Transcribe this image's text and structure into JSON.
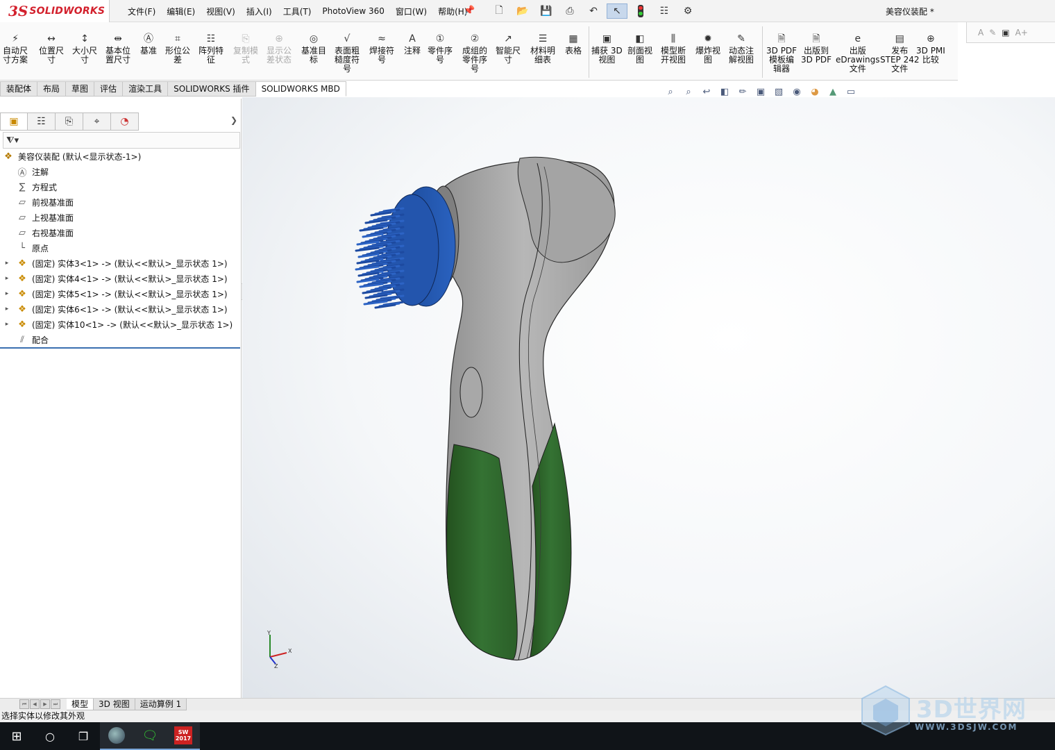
{
  "app": {
    "logo_mark": "3S",
    "logo_text": "SOLIDWORKS",
    "document_title": "美容仪装配 *"
  },
  "menus": [
    "文件(F)",
    "编辑(E)",
    "视图(V)",
    "插入(I)",
    "工具(T)",
    "PhotoView 360",
    "窗口(W)",
    "帮助(H)"
  ],
  "quick_icons": [
    "new-document-icon",
    "open-icon",
    "save-icon",
    "print-icon",
    "undo-icon",
    "select-pointer-icon",
    "rebuild-traffic-light-icon",
    "file-properties-icon",
    "options-gear-icon"
  ],
  "commands": [
    {
      "label": "自动尺\n寸方案",
      "icon": "auto-dimension-icon",
      "enabled": true
    },
    {
      "label": "位置尺\n寸",
      "icon": "location-dimension-icon",
      "enabled": true
    },
    {
      "label": "大小尺\n寸",
      "icon": "size-dimension-icon",
      "enabled": true
    },
    {
      "label": "基本位\n置尺寸",
      "icon": "basic-location-dimension-icon",
      "enabled": true
    },
    {
      "label": "基准",
      "icon": "datum-icon",
      "enabled": true
    },
    {
      "label": "形位公\n差",
      "icon": "geometric-tolerance-icon",
      "enabled": true
    },
    {
      "label": "阵列特\n征",
      "icon": "pattern-feature-icon",
      "enabled": true
    },
    {
      "label": "复制模\n式",
      "icon": "copy-scheme-icon",
      "enabled": false
    },
    {
      "label": "显示公\n差状态",
      "icon": "tolerance-status-icon",
      "enabled": false
    },
    {
      "label": "基准目\n标",
      "icon": "datum-target-icon",
      "enabled": true
    },
    {
      "label": "表面粗\n糙度符\n号",
      "icon": "surface-finish-icon",
      "enabled": true
    },
    {
      "label": "焊接符\n号",
      "icon": "weld-symbol-icon",
      "enabled": true
    },
    {
      "label": "注释",
      "icon": "note-icon",
      "enabled": true
    },
    {
      "label": "零件序\n号",
      "icon": "balloon-icon",
      "enabled": true
    },
    {
      "label": "成组的\n零件序\n号",
      "icon": "stacked-balloon-icon",
      "enabled": true
    },
    {
      "label": "智能尺\n寸",
      "icon": "smart-dimension-icon",
      "enabled": true
    },
    {
      "label": "材料明\n细表",
      "icon": "bom-icon",
      "enabled": true
    },
    {
      "label": "表格",
      "icon": "table-icon",
      "enabled": true
    },
    {
      "label": "捕获 3D\n视图",
      "icon": "capture-3d-view-icon",
      "enabled": true
    },
    {
      "label": "剖面视\n图",
      "icon": "section-view-icon",
      "enabled": true
    },
    {
      "label": "模型断\n开视图",
      "icon": "model-break-view-icon",
      "enabled": true
    },
    {
      "label": "爆炸视\n图",
      "icon": "exploded-view-icon",
      "enabled": true
    },
    {
      "label": "动态注\n解视图",
      "icon": "dynamic-annotation-icon",
      "enabled": true
    },
    {
      "label": "3D PDF\n模板编\n辑器",
      "icon": "3d-pdf-template-icon",
      "enabled": true
    },
    {
      "label": "出版到\n3D PDF",
      "icon": "publish-3d-pdf-icon",
      "enabled": true
    },
    {
      "label": "出版\neDrawings\n文件",
      "icon": "edrawings-icon",
      "enabled": true
    },
    {
      "label": "发布\nSTEP 242\n文件",
      "icon": "step-242-icon",
      "enabled": true
    },
    {
      "label": "3D PMI\n比较",
      "icon": "pmi-compare-icon",
      "enabled": true
    }
  ],
  "command_tabs": [
    "装配体",
    "布局",
    "草图",
    "评估",
    "渲染工具",
    "SOLIDWORKS 插件",
    "SOLIDWORKS MBD"
  ],
  "active_command_tab": "SOLIDWORKS MBD",
  "feature_tree": {
    "root": "美容仪装配  (默认<显示状态-1>)",
    "items": [
      {
        "label": "注解",
        "icon": "annotations-icon",
        "expandable": false
      },
      {
        "label": "方程式",
        "icon": "equations-icon",
        "expandable": false
      },
      {
        "label": "前视基准面",
        "icon": "plane-icon",
        "expandable": false
      },
      {
        "label": "上视基准面",
        "icon": "plane-icon",
        "expandable": false
      },
      {
        "label": "右视基准面",
        "icon": "plane-icon",
        "expandable": false
      },
      {
        "label": "原点",
        "icon": "origin-icon",
        "expandable": false
      },
      {
        "label": "(固定) 实体3<1> -> (默认<<默认>_显示状态 1>)",
        "icon": "part-icon",
        "expandable": true
      },
      {
        "label": "(固定) 实体4<1> -> (默认<<默认>_显示状态 1>)",
        "icon": "part-icon",
        "expandable": true
      },
      {
        "label": "(固定) 实体5<1> -> (默认<<默认>_显示状态 1>)",
        "icon": "part-icon",
        "expandable": true
      },
      {
        "label": "(固定) 实体6<1> -> (默认<<默认>_显示状态 1>)",
        "icon": "part-icon",
        "expandable": true
      },
      {
        "label": "(固定) 实体10<1> -> (默认<<默认>_显示状态 1>)",
        "icon": "part-icon",
        "expandable": true
      },
      {
        "label": "配合",
        "icon": "mates-icon",
        "expandable": false
      }
    ]
  },
  "bottom_tabs": [
    "模型",
    "3D 视图",
    "运动算例 1"
  ],
  "active_bottom_tab": "模型",
  "status_text": "选择实体以修改其外观",
  "triad_labels": {
    "x": "X",
    "y": "Y",
    "z": "Z"
  },
  "taskbar": [
    "windows-start-icon",
    "search-circle-icon",
    "task-view-icon",
    "browser-app-icon",
    "wechat-app-icon",
    "solidworks-2017-app-icon"
  ],
  "taskbar_app_label": "SW\n2017",
  "watermark": {
    "brand": "3D世界网",
    "url": "WWW.3DSJW.COM"
  },
  "colors": {
    "brand_red": "#d3212d",
    "model_gray": "#a5a5a5",
    "model_green": "#2f6a2d",
    "model_blue": "#1f52a8",
    "tree_accent": "#3a6fb0"
  }
}
